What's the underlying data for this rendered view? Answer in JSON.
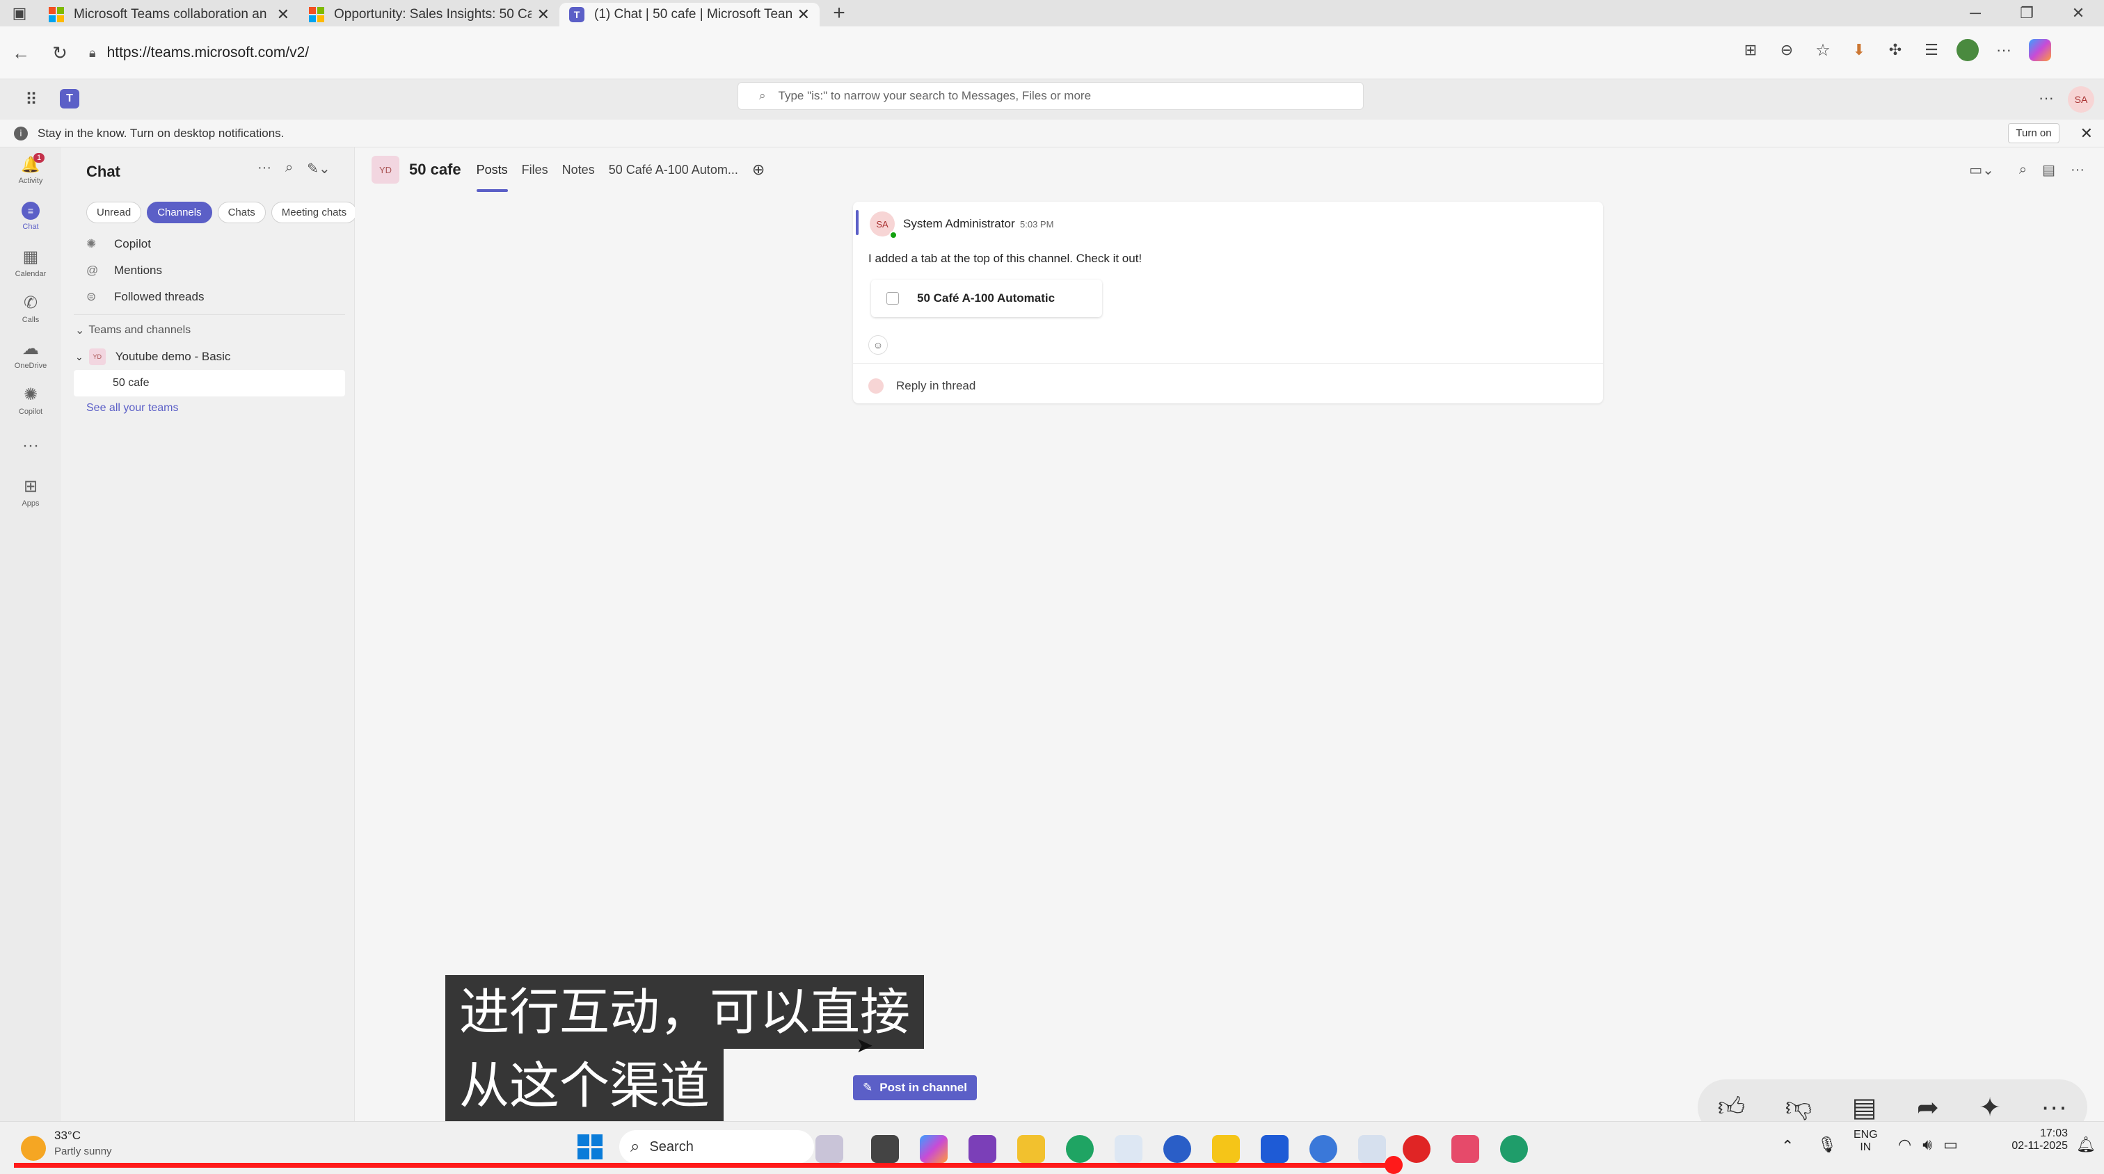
{
  "browser": {
    "tabs": [
      {
        "title": "Microsoft Teams collaboration an",
        "active": false
      },
      {
        "title": "Opportunity: Sales Insights: 50 Ca",
        "active": false
      },
      {
        "title": "(1) Chat | 50 cafe | Microsoft Tean",
        "active": true
      }
    ],
    "new_tab_label": "+",
    "url": "https://teams.microsoft.com/v2/"
  },
  "teams": {
    "search_placeholder": "Type \"is:\" to narrow your search to Messages, Files or more",
    "avatar": "SA"
  },
  "notification": {
    "text": "Stay in the know. Turn on desktop notifications.",
    "button": "Turn on"
  },
  "rail": [
    {
      "label": "Activity",
      "icon": "bell-icon",
      "glyph": "🔔",
      "badge": "1"
    },
    {
      "label": "Chat",
      "icon": "chat-icon",
      "glyph": "💬"
    },
    {
      "label": "Calendar",
      "icon": "calendar-icon",
      "glyph": "▦"
    },
    {
      "label": "Calls",
      "icon": "phone-icon",
      "glyph": "✆"
    },
    {
      "label": "OneDrive",
      "icon": "cloud-icon",
      "glyph": "☁"
    },
    {
      "label": "Copilot",
      "icon": "copilot-icon",
      "glyph": "✺"
    },
    {
      "label": "",
      "icon": "more-icon",
      "glyph": "···"
    },
    {
      "label": "Apps",
      "icon": "apps-icon",
      "glyph": "⊞"
    }
  ],
  "chat_panel": {
    "title": "Chat",
    "filters": [
      "Unread",
      "Channels",
      "Chats",
      "Meeting chats"
    ],
    "selected_filter": "Channels",
    "quick_items": [
      "Copilot",
      "Mentions",
      "Followed threads"
    ],
    "section": "Teams and channels",
    "team": {
      "initials": "YD",
      "name": "Youtube demo - Basic"
    },
    "channel": "50 cafe",
    "see_all": "See all your teams"
  },
  "channel": {
    "initials": "YD",
    "name": "50 cafe",
    "tabs": [
      "Posts",
      "Files",
      "Notes",
      "50 Café A-100 Autom..."
    ],
    "selected_tab": "Posts"
  },
  "post": {
    "author_initials": "SA",
    "author": "System Administrator",
    "time": "5:03 PM",
    "message": "I added a tab at the top of this channel. Check it out!",
    "card_title": "50 Café A-100 Automatic",
    "reply": "Reply in thread"
  },
  "subtitle": {
    "line1": "进行互动，可以直接",
    "line2": "从这个渠道"
  },
  "post_button": "Post in channel",
  "taskbar": {
    "weather_temp": "33°C",
    "weather_desc": "Partly sunny",
    "search": "Search",
    "lang1": "ENG",
    "lang2": "IN",
    "time": "17:03",
    "date": "02-11-2025"
  },
  "colors": {
    "accent": "#5b5fc7",
    "progress": "#ff1a1a"
  }
}
